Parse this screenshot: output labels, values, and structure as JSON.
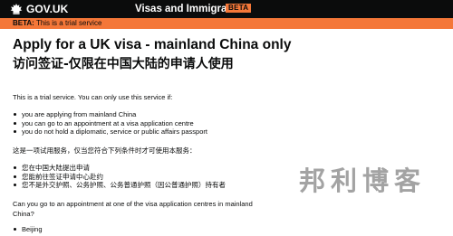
{
  "header": {
    "brand": "GOV.UK",
    "service_name": "Visas and Immigration",
    "phase_tag": "BETA"
  },
  "banner": {
    "label": "BETA:",
    "text": "This is a trial service"
  },
  "main": {
    "title": "Apply for a UK visa - mainland China only",
    "title_zh": "访问签证-仅限在中国大陆的申请人使用",
    "intro": "This is a trial service. You can only use this service if:",
    "conditions": [
      "you are applying from mainland China",
      "you can go to an appointment at a visa application centre",
      "you do not hold a diplomatic, service or public affairs passport"
    ],
    "intro_zh": "这是一项试用服务，仅当您符合下列条件时才可使用本服务：",
    "conditions_zh": [
      "您在中国大陆提出申请",
      "您能前往签证申请中心赴约",
      "您不是外交护照、公务护照、公务普通护照（因公普通护照）持有者"
    ],
    "question": "Can you go to an appointment at one of the visa application centres in mainland China?",
    "answers": [
      "Beijing"
    ]
  },
  "watermark": "邦利博客",
  "colors": {
    "header_bg": "#0b0c0c",
    "phase_orange": "#f47738",
    "text": "#0b0c0c"
  },
  "icons": {
    "logo": "crown-icon"
  }
}
